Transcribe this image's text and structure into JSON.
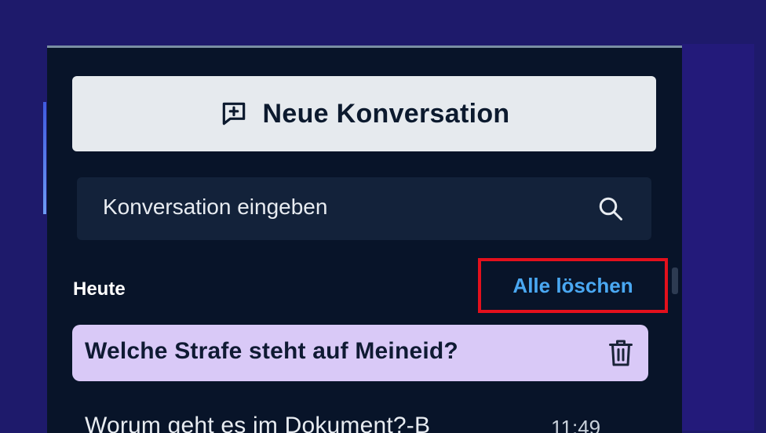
{
  "sidebar": {
    "new_conversation_label": "Neue Konversation",
    "search": {
      "placeholder": "Konversation eingeben"
    },
    "section_title": "Heute",
    "clear_all_label": "Alle löschen",
    "conversations": [
      {
        "title": "Welche Strafe steht auf Meineid?",
        "time": "",
        "active": true
      },
      {
        "title": "Worum geht es im Dokument?-B",
        "time": "11:49",
        "active": false
      }
    ]
  },
  "icons": {
    "new": "message-plus-icon",
    "search": "search-icon",
    "delete": "trash-icon"
  },
  "colors": {
    "page_background": "#1e1a6b",
    "panel": "#081429",
    "button": "#e6eaee",
    "active_item": "#d9c9f7",
    "link": "#4aa8f2",
    "highlight": "#e3101c"
  }
}
